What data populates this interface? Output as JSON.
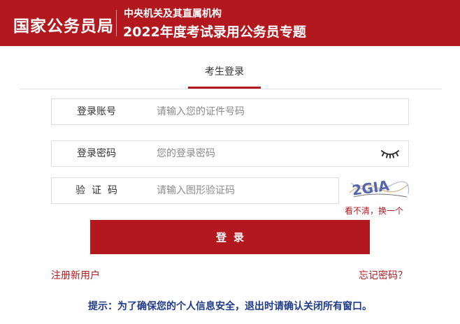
{
  "header": {
    "brand": "国家公务员局",
    "subtitle": "中央机关及其直属机构",
    "title": "2022年度考试录用公务员专题"
  },
  "tabs": [
    {
      "label": "考生登录",
      "active": true
    }
  ],
  "form": {
    "account": {
      "label": "登录账号",
      "placeholder": "请输入您的证件号码"
    },
    "password": {
      "label": "登录密码",
      "placeholder": "您的登录密码",
      "toggle_icon": "eye-closed-icon"
    },
    "captcha": {
      "label": "验证码",
      "placeholder": "请输入图形验证码",
      "image_text": "2GIA",
      "refresh_label": "看不清，换一个"
    },
    "submit_label": "登录"
  },
  "links": {
    "register": "注册新用户",
    "forgot": "忘记密码？"
  },
  "notice": "提示：为了确保您的个人信息安全，退出时请确认关闭所有窗口。",
  "colors": {
    "brand_red": "#b3181f",
    "notice_blue": "#1f3b8a"
  }
}
